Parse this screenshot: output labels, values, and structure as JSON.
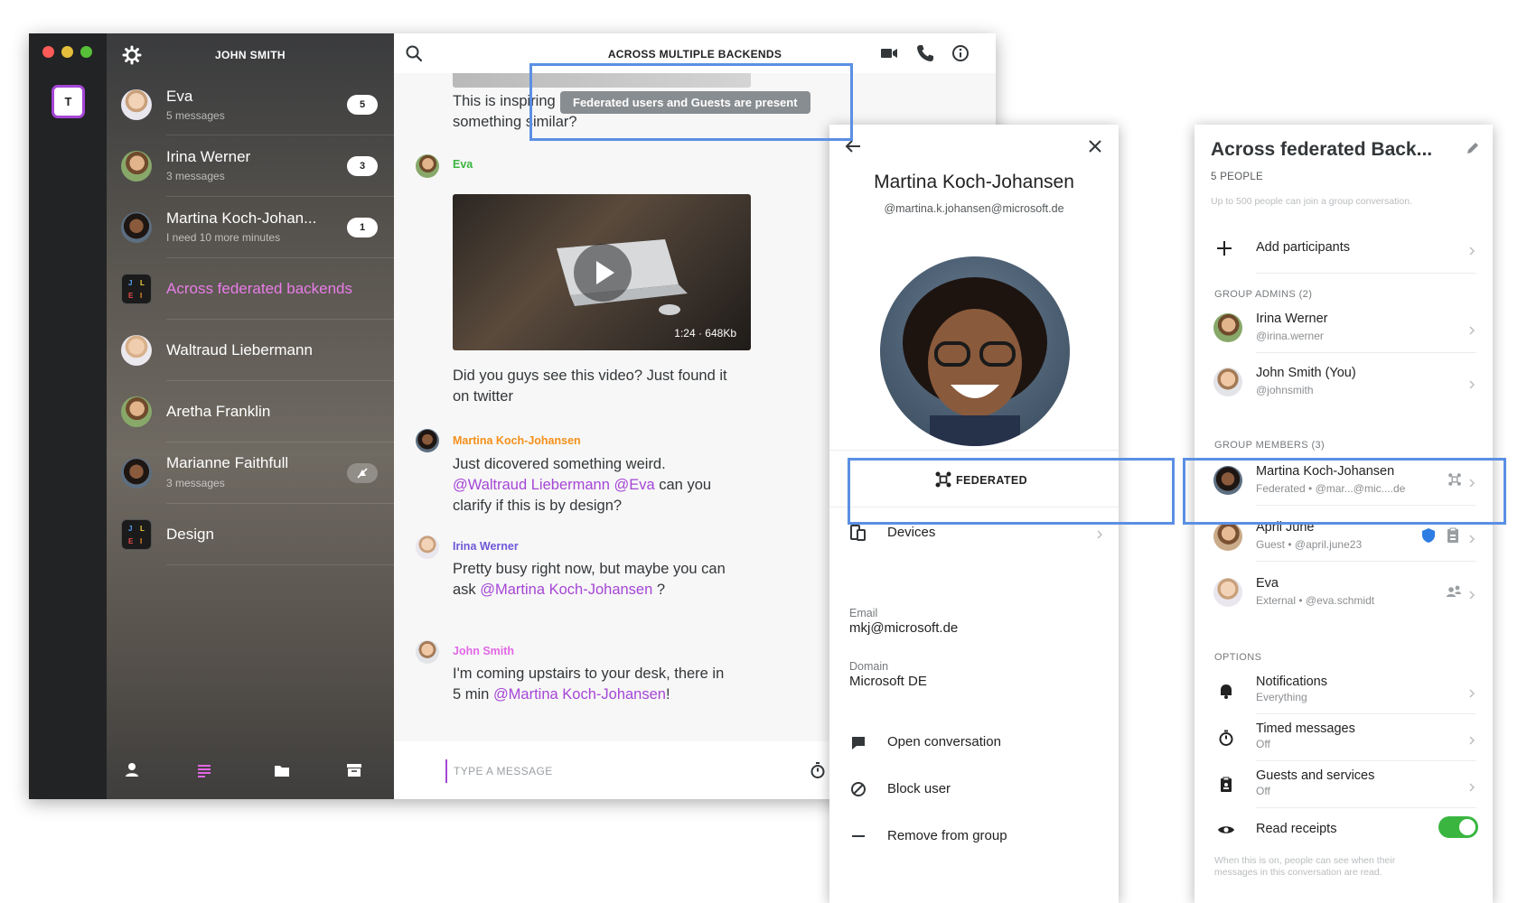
{
  "window": {
    "account_name": "JOHN SMITH",
    "team_initial": "T"
  },
  "conversations": [
    {
      "name": "Eva",
      "sub": "5 messages",
      "badge": "5"
    },
    {
      "name": "Irina Werner",
      "sub": "3 messages",
      "badge": "3"
    },
    {
      "name": "Martina Koch-Johan...",
      "sub": "I need 10 more minutes",
      "badge": "1"
    },
    {
      "name": "Across federated backends",
      "sub": "",
      "badge": ""
    },
    {
      "name": "Waltraud Liebermann",
      "sub": "",
      "badge": ""
    },
    {
      "name": "Aretha Franklin",
      "sub": "",
      "badge": ""
    },
    {
      "name": "Marianne Faithfull",
      "sub": "3 messages",
      "badge": ""
    },
    {
      "name": "Design",
      "sub": "",
      "badge": ""
    }
  ],
  "group_avatar_letters": [
    "J",
    "L",
    "E",
    "I"
  ],
  "colors": {
    "accent": "#a546d6",
    "active_conversation": "#e97de8",
    "eva": "#3ab640",
    "martina": "#f4901a",
    "irina": "#6f58d8",
    "john": "#e267e6",
    "highlight": "#5b8fe4",
    "toggle_on": "#3ab640",
    "guest_shield": "#2e7de3"
  },
  "conversation": {
    "title": "ACROSS MULTIPLE BACKENDS",
    "tooltip": "Federated users and Guests are present",
    "messages": {
      "first_line1": "This is inspiring",
      "first_line2": "something similar?",
      "eva_sender": "Eva",
      "video_meta": "1:24 · 648Kb",
      "eva_text_line1": "Did you guys see this video? Just found it",
      "eva_text_line2": "on twitter",
      "martina_sender": "Martina Koch-Johansen",
      "martina_line1": "Just dicovered something weird.",
      "martina_mention1": "@Waltraud Liebermann",
      "martina_mention2": "@Eva",
      "martina_line2_tail": " can you",
      "martina_line3": "clarify if this is by design?",
      "irina_sender": "Irina Werner",
      "irina_line1": "Pretty busy right now, but maybe you can",
      "irina_line2_head": "ask ",
      "irina_mention": "@Martina Koch-Johansen",
      "irina_line2_tail": " ?",
      "john_sender": "John Smith",
      "john_line1": "I'm coming upstairs to your desk, there in",
      "john_line2_head": "5 min ",
      "john_mention": "@Martina Koch-Johansen",
      "john_line2_tail": "!"
    },
    "input_placeholder": "TYPE A MESSAGE"
  },
  "profile": {
    "name": "Martina Koch-Johansen",
    "handle": "@martina.k.johansen@microsoft.de",
    "federated_label": "FEDERATED",
    "devices_label": "Devices",
    "email_label": "Email",
    "email_value": "mkj@microsoft.de",
    "domain_label": "Domain",
    "domain_value": "Microsoft DE",
    "open_conversation": "Open conversation",
    "block_user": "Block user",
    "remove_from_group": "Remove from group"
  },
  "group": {
    "title": "Across federated Back...",
    "people_count": "5 PEOPLE",
    "people_hint": "Up to 500 people can join a group conversation.",
    "add_participants": "Add participants",
    "admins_header": "GROUP ADMINS (2)",
    "admins": [
      {
        "name": "Irina Werner",
        "sub": "@irina.werner"
      },
      {
        "name": "John Smith (You)",
        "sub": "@johnsmith"
      }
    ],
    "members_header": "GROUP MEMBERS (3)",
    "members": [
      {
        "name": "Martina Koch-Johansen",
        "sub": "Federated • @mar...@mic....de"
      },
      {
        "name": "April June",
        "sub": "Guest • @april.june23"
      },
      {
        "name": "Eva",
        "sub": "External • @eva.schmidt"
      }
    ],
    "options_header": "OPTIONS",
    "options": [
      {
        "name": "Notifications",
        "sub": "Everything"
      },
      {
        "name": "Timed messages",
        "sub": "Off"
      },
      {
        "name": "Guests and services",
        "sub": "Off"
      },
      {
        "name": "Read receipts",
        "sub": ""
      }
    ],
    "read_receipts_on": true,
    "receipts_hint": "When this is on, people can see when their messages in this conversation are read."
  },
  "icons": {
    "settings": "gear-icon",
    "search": "search-icon",
    "video_call": "video-camera-icon",
    "audio_call": "phone-icon",
    "info": "info-icon",
    "back": "arrow-left-icon",
    "close": "close-icon",
    "federated": "federated-icon",
    "devices": "devices-icon",
    "edit": "pencil-icon",
    "timer": "timer-icon"
  }
}
